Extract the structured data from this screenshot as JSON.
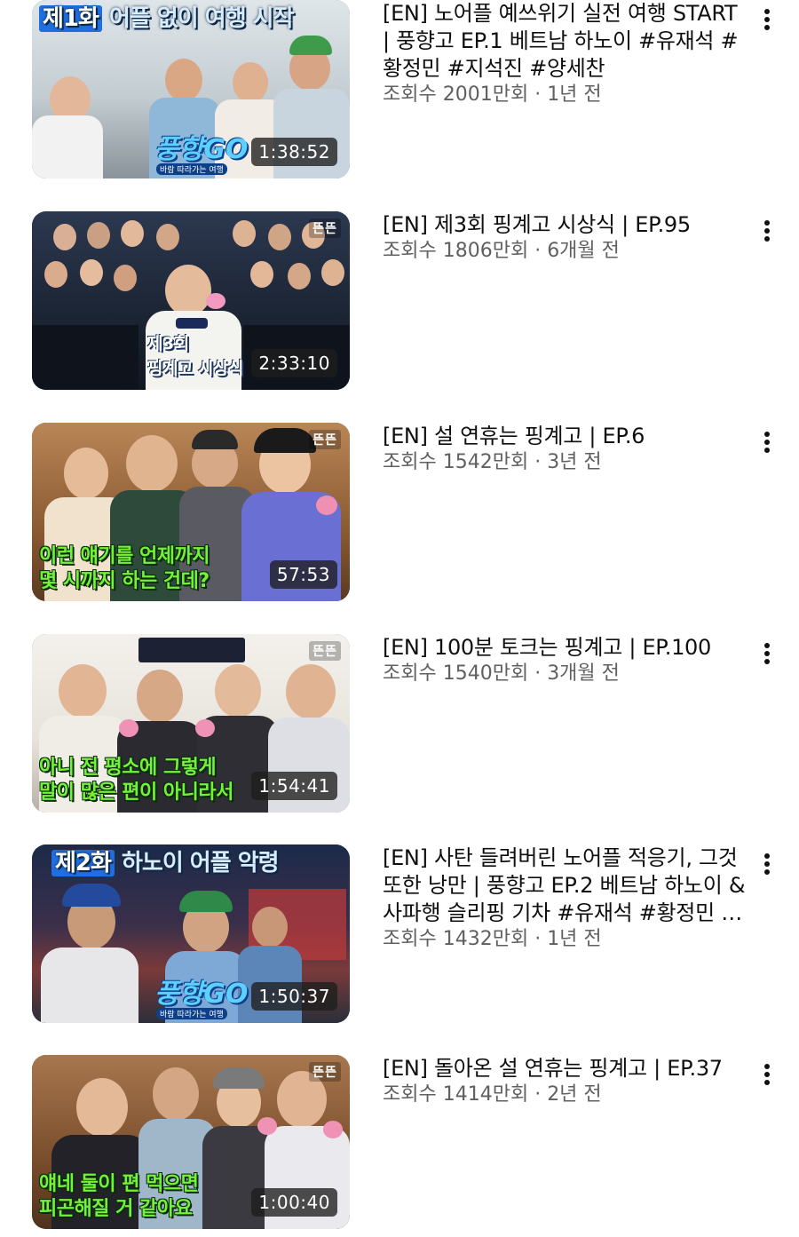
{
  "videos": [
    {
      "banner_ep": "제1화",
      "banner_rest": "어플 없이 여행 시작",
      "show_logo": "풍향GO",
      "show_logo_sub": "바람 따라가는 여행",
      "duration": "1:38:52",
      "title": "[EN] 노어플 예쓰위기 실전 여행 START | 풍향고 EP.1 베트남 하노이 #유재석 #황정민 #지석진 #양세찬",
      "views": "조회수 2001만회",
      "separator": "·",
      "age": "1년 전",
      "palette": {
        "bg": "#b9c4c9",
        "bg2": "#e9eef0",
        "floor": "#8a9399"
      }
    },
    {
      "caption": "제3회\n핑계고 시상식",
      "logo_mark": "뜬뜬",
      "duration": "2:33:10",
      "title": "[EN] 제3회 핑계고 시상식 | EP.95",
      "views": "조회수 1806만회",
      "separator": "·",
      "age": "6개월 전",
      "palette": {
        "bg": "#1b2433",
        "bg2": "#2c3850",
        "floor": "#111722"
      }
    },
    {
      "caption": "이런 얘기를 언제까지\n몇 시까지 하는 건데?",
      "logo_mark": "뜬뜬",
      "duration": "57:53",
      "title": "[EN] 설 연휴는 핑계고  |  EP.6",
      "views": "조회수 1542만회",
      "separator": "·",
      "age": "3년 전",
      "palette": {
        "bg": "#8a5a33",
        "bg2": "#b98656",
        "floor": "#5b3a22"
      }
    },
    {
      "caption": "아니 전 평소에 그렇게\n말이 많은 편이 아니라서",
      "logo_mark": "뜬뜬",
      "duration": "1:54:41",
      "title": "[EN] 100분 토크는 핑계고 | EP.100",
      "views": "조회수 1540만회",
      "separator": "·",
      "age": "3개월 전",
      "palette": {
        "bg": "#e7e3dc",
        "bg2": "#f4f1ec",
        "floor": "#b7b0a6"
      }
    },
    {
      "banner_ep": "제2화",
      "banner_rest": "하노이 어플 악령",
      "show_logo": "풍향GO",
      "show_logo_sub": "바람 따라가는 여행",
      "duration": "1:50:37",
      "title": "[EN] 사탄 들려버린 노어플 적응기, 그것 또한 낭만 | 풍향고 EP.2 베트남 하노이 & 사파행 슬리핑 기차 #유재석 #황정민 #지석진 #양세찬",
      "views": "조회수 1432만회",
      "separator": "·",
      "age": "1년 전",
      "palette": {
        "bg": "#1c2a4a",
        "bg2": "#7a3a3a",
        "floor": "#2b2f3a"
      }
    },
    {
      "caption": "얘네 둘이 편 먹으면\n피곤해질 거 같아요",
      "logo_mark": "뜬뜬",
      "duration": "1:00:40",
      "title": "[EN] 돌아온 설 연휴는 핑계고  |  EP.37",
      "views": "조회수 1414만회",
      "separator": "·",
      "age": "2년 전",
      "palette": {
        "bg": "#7a4d2c",
        "bg2": "#a7774e",
        "floor": "#4e321d"
      }
    }
  ]
}
